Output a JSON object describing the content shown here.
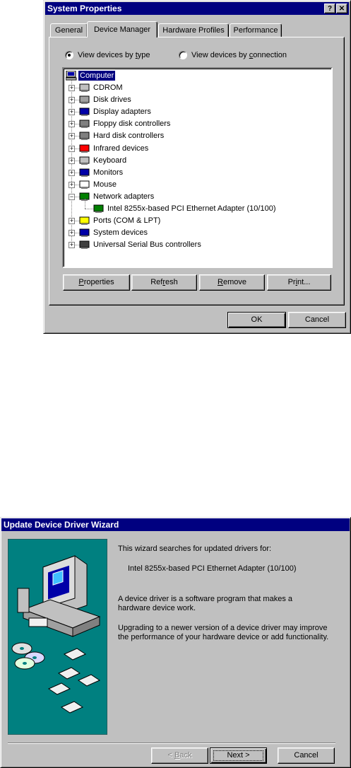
{
  "system_properties": {
    "title": "System Properties",
    "help_btn": "?",
    "close_btn": "✕",
    "tabs": [
      {
        "label": "General",
        "active": false
      },
      {
        "label": "Device Manager",
        "active": true
      },
      {
        "label": "Hardware Profiles",
        "active": false
      },
      {
        "label": "Performance",
        "active": false
      }
    ],
    "view_by_type": {
      "prefix": "View devices by ",
      "key": "t",
      "suffix": "ype",
      "checked": true
    },
    "view_by_connection": {
      "prefix": "View devices by ",
      "key": "c",
      "suffix": "onnection",
      "checked": false
    },
    "tree": {
      "root": "Computer",
      "items": [
        {
          "label": "CDROM",
          "icon": "cdrom-icon",
          "expand": "+"
        },
        {
          "label": "Disk drives",
          "icon": "disk-drive-icon",
          "expand": "+"
        },
        {
          "label": "Display adapters",
          "icon": "display-adapter-icon",
          "expand": "+"
        },
        {
          "label": "Floppy disk controllers",
          "icon": "floppy-controller-icon",
          "expand": "+"
        },
        {
          "label": "Hard disk controllers",
          "icon": "hard-disk-controller-icon",
          "expand": "+"
        },
        {
          "label": "Infrared devices",
          "icon": "infrared-icon",
          "expand": "+"
        },
        {
          "label": "Keyboard",
          "icon": "keyboard-icon",
          "expand": "+"
        },
        {
          "label": "Monitors",
          "icon": "monitor-icon",
          "expand": "+"
        },
        {
          "label": "Mouse",
          "icon": "mouse-icon",
          "expand": "+"
        },
        {
          "label": "Network adapters",
          "icon": "network-adapter-icon",
          "expand": "−"
        },
        {
          "label": "Intel 8255x-based PCI Ethernet Adapter (10/100)",
          "icon": "network-card-icon",
          "child": true
        },
        {
          "label": "Ports (COM & LPT)",
          "icon": "port-icon",
          "expand": "+"
        },
        {
          "label": "System devices",
          "icon": "system-device-icon",
          "expand": "+"
        },
        {
          "label": "Universal Serial Bus controllers",
          "icon": "usb-icon",
          "expand": "+"
        }
      ]
    },
    "buttons": {
      "properties": {
        "key": "P",
        "rest": "roperties"
      },
      "refresh": {
        "pre": "Ref",
        "key": "r",
        "rest": "esh"
      },
      "remove": {
        "pre": "",
        "key": "R",
        "rest": "emove"
      },
      "print": {
        "pre": "Pr",
        "key": "i",
        "rest": "nt..."
      },
      "ok": "OK",
      "cancel": "Cancel"
    }
  },
  "wizard": {
    "title": "Update Device Driver Wizard",
    "line1": "This wizard searches for updated drivers for:",
    "device": "Intel 8255x-based PCI Ethernet Adapter (10/100)",
    "para1": "A device driver is a software program that makes a hardware device work.",
    "para2": "Upgrading to a newer version of a device driver may improve the performance of your hardware device or add functionality.",
    "back": {
      "pre": "< ",
      "key": "B",
      "rest": "ack"
    },
    "next": {
      "pre": "Next >",
      "key": "",
      "rest": ""
    },
    "cancel": "Cancel",
    "art_bg": "#008080"
  }
}
